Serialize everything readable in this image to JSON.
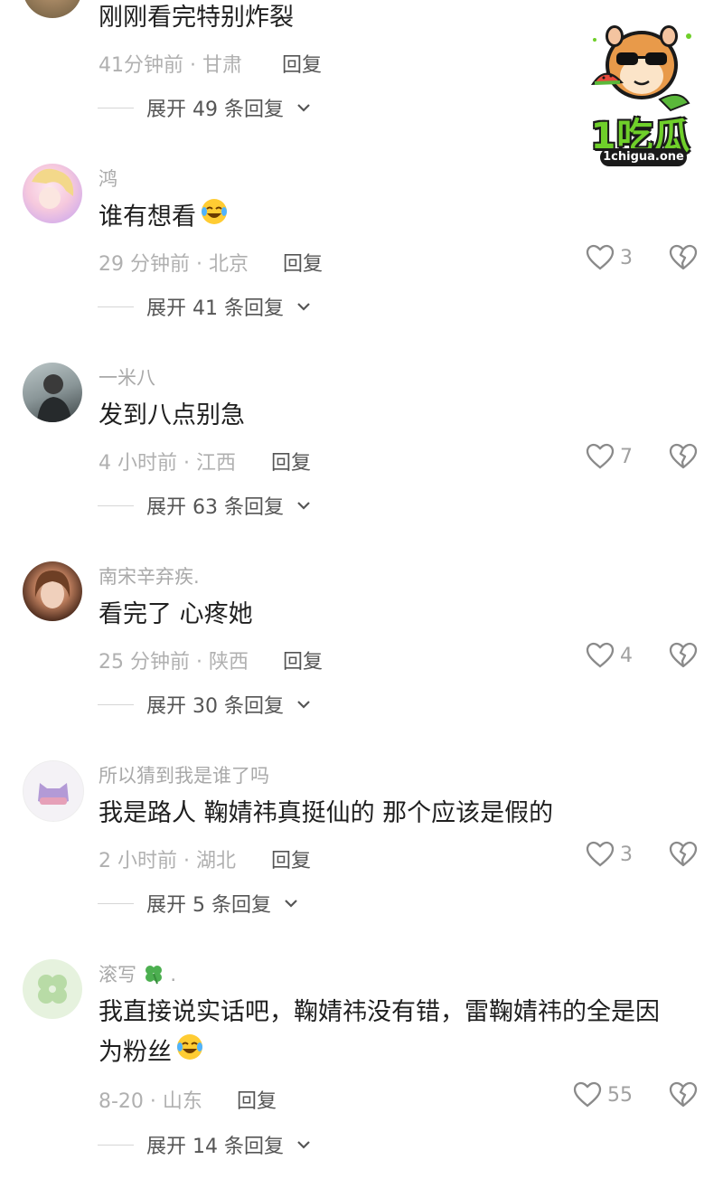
{
  "comments": [
    {
      "text": "刚刚看完特别炸裂",
      "time": "41分钟前 · 甘肃",
      "reply": "回复",
      "expand": "展开 49 条回复"
    },
    {
      "username": "鸿",
      "text": "谁有想看",
      "emoji": "laughing-cry-icon",
      "time": "29 分钟前 · 北京",
      "reply": "回复",
      "likes": "3",
      "expand": "展开 41 条回复"
    },
    {
      "username": "一米八",
      "text": "发到八点别急",
      "time": "4 小时前 · 江西",
      "reply": "回复",
      "likes": "7",
      "expand": "展开 63 条回复"
    },
    {
      "username": "南宋辛弃疾.",
      "text": "看完了 心疼她",
      "time": "25 分钟前 · 陕西",
      "reply": "回复",
      "likes": "4",
      "expand": "展开 30 条回复"
    },
    {
      "username": "所以猜到我是谁了吗",
      "text": "我是路人 鞠婧祎真挺仙的 那个应该是假的",
      "time": "2 小时前 · 湖北",
      "reply": "回复",
      "likes": "3",
      "expand": "展开 5 条回复"
    },
    {
      "username": "滚写",
      "username_suffix": ".",
      "text_line1": "我直接说实话吧，鞠婧祎没有错，雷鞠婧祎的全是因",
      "text_line2": "为粉丝",
      "emoji": "laughing-cry-icon",
      "time": "8-20 · 山东",
      "reply": "回复",
      "likes": "55",
      "expand": "展开 14 条回复"
    }
  ],
  "watermark": {
    "brand": "1吃瓜",
    "url": "1chigua.one"
  },
  "colors": {
    "username": "#a9a9a9",
    "meta": "#b0b0b0",
    "brand_green": "#6fcf2a"
  }
}
